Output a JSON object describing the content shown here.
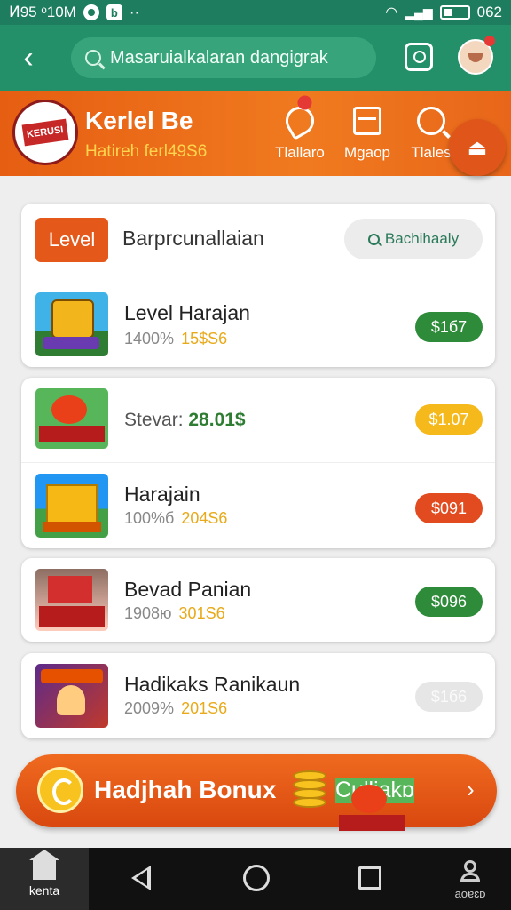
{
  "status_bar": {
    "left_text": "Ͷ95 ᵒ10M",
    "b_glyph": "b",
    "dots": "··",
    "right_text": "062"
  },
  "header": {
    "search_placeholder": "Masaruialkalaran dangigrak"
  },
  "banner": {
    "logo_text": "KERUSI",
    "title": "Kerlel Be",
    "subtitle": "Hatireh ferl49S6",
    "nav": [
      {
        "label": "Tlallaro",
        "icon": "tap-icon"
      },
      {
        "label": "Mgaop",
        "icon": "map-icon"
      },
      {
        "label": "Tlales",
        "icon": "search-icon"
      }
    ],
    "fab_icon": "menu-icon"
  },
  "card_header": {
    "level_button": "Level",
    "title": "Barprcunallaian",
    "search_pill": "Bachihaaly"
  },
  "items": [
    {
      "name": "Level Harajan",
      "sub_gray": "1400%",
      "sub_gold": "15$S6",
      "price": "$1б7",
      "price_color": "#2e8b3a"
    },
    {
      "name": "Stevar:",
      "inline_value": "28.01$",
      "price": "$1.07",
      "price_color": "#f5b91c"
    },
    {
      "name": "Harajain",
      "sub_gray": "100%б",
      "sub_gold": "204S6",
      "price": "$091",
      "price_color": "#e14b1f"
    },
    {
      "name": "Bevad Panian",
      "sub_gray": "1908ю",
      "sub_gold": "301S6",
      "price": "$096",
      "price_color": "#2e8b3a"
    },
    {
      "name": "Hadikaks Ranikaun",
      "sub_gray": "2009%",
      "sub_gold": "201S6",
      "price": "$1б6",
      "price_color": "#e6e6e6"
    }
  ],
  "bonus": {
    "title": "Hadjhah Bonux",
    "action": "Culljakɒ",
    "chevron": "›"
  },
  "nav_bar": {
    "home_label": "kenta",
    "profile_label": "aoɐɛᴅ"
  }
}
